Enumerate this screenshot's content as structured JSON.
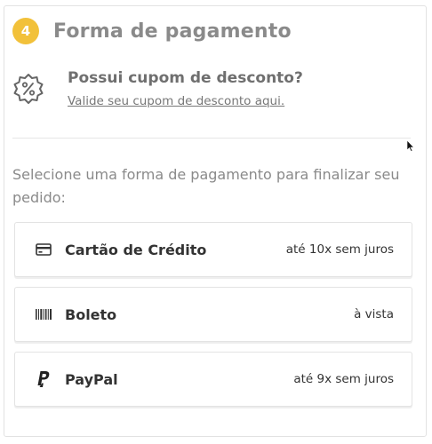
{
  "header": {
    "step_number": "4",
    "title": "Forma de pagamento"
  },
  "coupon": {
    "question": "Possui cupom de desconto?",
    "link_label": "Valide seu cupom de desconto aqui."
  },
  "instruction": "Selecione uma forma de pagamento para finalizar seu pedido:",
  "payment_options": [
    {
      "name": "Cartão de Crédito",
      "detail": "até 10x sem juros",
      "icon": "credit-card-icon"
    },
    {
      "name": "Boleto",
      "detail": "à vista",
      "icon": "barcode-icon"
    },
    {
      "name": "PayPal",
      "detail": "até 9x sem juros",
      "icon": "paypal-icon"
    }
  ],
  "colors": {
    "step_badge": "#f2c13a",
    "title": "#8a8a8a",
    "text_dark": "#333333"
  }
}
